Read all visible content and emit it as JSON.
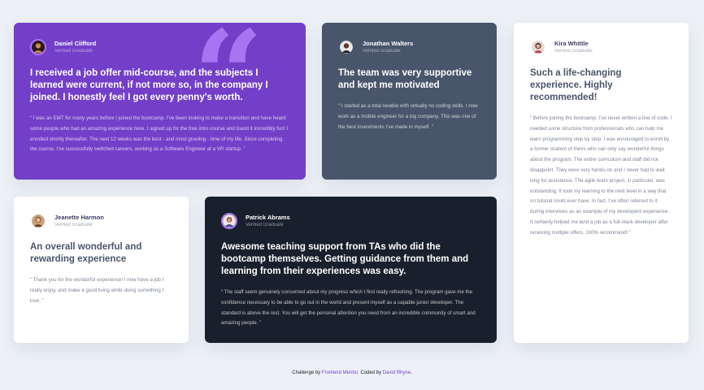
{
  "colors": {
    "moderate_violet": "#733fc8",
    "grayish_blue": "#48556a",
    "very_dark_blue": "#19202d",
    "white": "#ffffff",
    "background": "#edf1f7",
    "light_violet": "#a775f1"
  },
  "testimonials": [
    {
      "name": "Daniel Clifford",
      "role": "Verified Graduate",
      "avatar_icon": "avatar-daniel",
      "headline": "I received a job offer mid-course, and the subjects I learned were current, if not more so, in the company I joined. I honestly feel I got every penny's worth.",
      "body": "“ I was an EMT for many years before I joined the bootcamp. I’ve been looking to make a transition and have heard some people who had an amazing experience here. I signed up for the free intro course and found it incredibly fun! I enrolled shortly thereafter. The next 12 weeks was the best - and most grueling - time of my life. Since completing the course, I’ve successfully switched careers, working as a Software Engineer at a VR startup. ”"
    },
    {
      "name": "Jonathan Walters",
      "role": "Verified Graduate",
      "avatar_icon": "avatar-jonathan",
      "headline": "The team was very supportive and kept me motivated",
      "body": "“ I started as a total newbie with virtually no coding skills. I now work as a mobile engineer for a big company. This was one of the best investments I’ve made in myself. ”"
    },
    {
      "name": "Kira Whittle",
      "role": "Verified Graduate",
      "avatar_icon": "avatar-kira",
      "headline": "Such a life-changing experience. Highly recommended!",
      "body": "“ Before joining the bootcamp, I’ve never written a line of code. I needed some structure from professionals who can help me learn programming step by step. I was encouraged to enroll by a former student of theirs who can only say wonderful things about the program. The entire curriculum and staff did not disappoint. They were very hands-on and I never had to wait long for assistance. The agile team project, in particular, was outstanding. It took my learning to the next level in a way that no tutorial could ever have. In fact, I’ve often referred to it during interviews as an example of my developent experience. It certainly helped me land a job as a full-stack developer after receiving multiple offers. 100% recommend! ”"
    },
    {
      "name": "Jeanette Harmon",
      "role": "Verified Graduate",
      "avatar_icon": "avatar-jeanette",
      "headline": "An overall wonderful and rewarding experience",
      "body": "“ Thank you for the wonderful experience! I now have a job I really enjoy, and make a good living while doing something I love. ”"
    },
    {
      "name": "Patrick Abrams",
      "role": "Verified Graduate",
      "avatar_icon": "avatar-patrick",
      "headline": "Awesome teaching support from TAs who did the bootcamp themselves. Getting guidance from them and learning from their experiences was easy.",
      "body": "“ The staff seem genuinely concerned about my progress which I find really refreshing. The program gave me the confidence necessary to be able to go out in the world and present myself as a capable junior developer. The standard is above the rest. You will get the personal attention you need from an incredible community of smart and amazing people. ”"
    }
  ],
  "footer": {
    "prefix": "Challenge by ",
    "link1": "Frontend Mentor",
    "middle": ". Coded by ",
    "link2": "David Rhyne",
    "suffix": "."
  }
}
